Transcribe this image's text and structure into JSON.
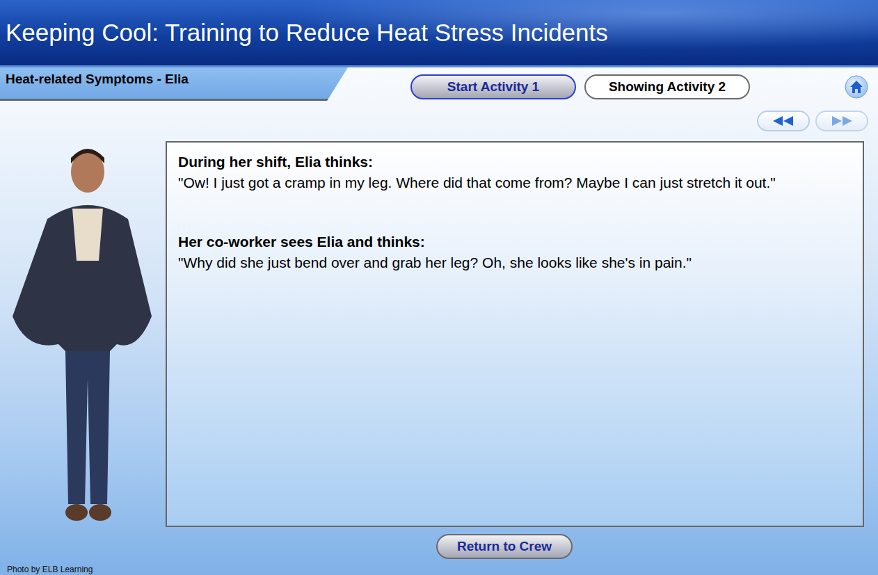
{
  "header": {
    "title": "Keeping Cool: Training to Reduce Heat Stress Incidents"
  },
  "section": {
    "title": "Heat-related Symptoms - Elia"
  },
  "activities": [
    {
      "label": "Start Activity 1",
      "selected": false
    },
    {
      "label": "Showing Activity 2",
      "selected": true
    }
  ],
  "thoughts": [
    {
      "speaker": "During her shift, Elia thinks:",
      "quote": "\"Ow! I just got a cramp in my leg. Where did that come from? Maybe I can just stretch it out.\""
    },
    {
      "speaker": "Her co-worker sees Elia and thinks:",
      "quote": "\"Why did she just bend over and grab her leg? Oh, she looks like she's in pain.\""
    }
  ],
  "return_button": "Return to Crew",
  "photo_credit": "Photo by ELB Learning"
}
